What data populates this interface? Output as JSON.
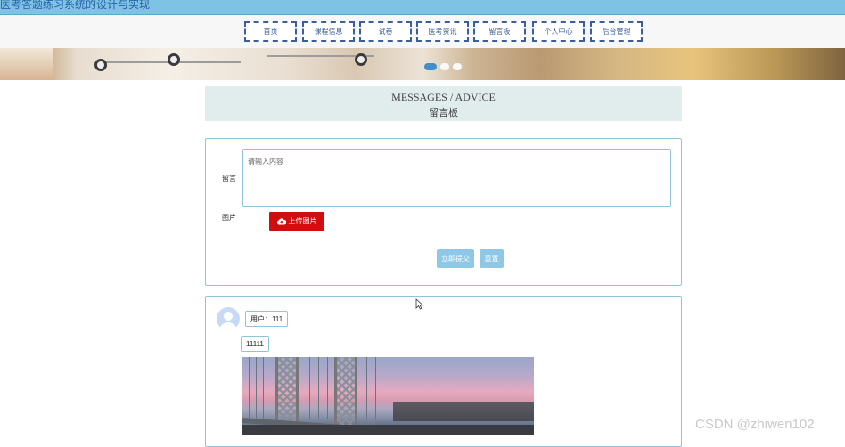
{
  "app": {
    "title": "医考答题练习系统的设计与实现"
  },
  "nav": {
    "items": [
      {
        "label": "首页"
      },
      {
        "label": "课程信息"
      },
      {
        "label": "试卷"
      },
      {
        "label": "医考资讯"
      },
      {
        "label": "留言板"
      },
      {
        "label": "个人中心"
      },
      {
        "label": "后台管理"
      }
    ]
  },
  "banner": {
    "slide_count": 3,
    "active_slide": 1
  },
  "heading": {
    "en": "MESSAGES / ADVICE",
    "cn": "留言板"
  },
  "form": {
    "message_label": "留言",
    "message_placeholder": "请输入内容",
    "image_label": "图片",
    "upload_label": "上传图片",
    "submit_label": "立即提交",
    "reset_label": "重置",
    "upload_color": "#d10d0d",
    "button_color": "#8ec8e6"
  },
  "posts": [
    {
      "user": "用户：111",
      "content": "11111"
    }
  ],
  "watermark": "CSDN @zhiwen102",
  "colors": {
    "titlebar": "#7ec3e3",
    "accent": "#2f86c8",
    "border": "#8ec3da"
  }
}
